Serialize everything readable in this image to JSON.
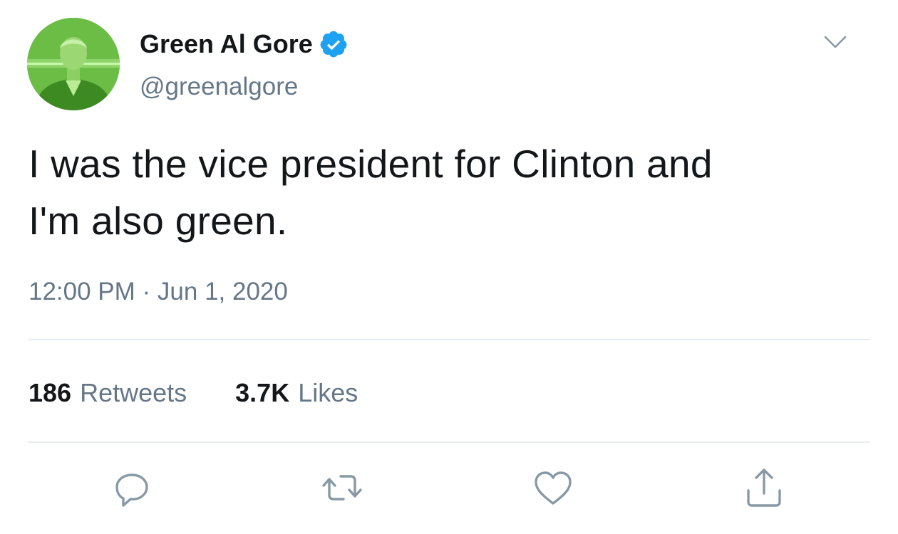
{
  "tweet": {
    "display_name": "Green Al Gore",
    "handle": "@greenalgore",
    "verified": true,
    "text_line1": "I was the vice president for Clinton and",
    "text_line2": "I'm also green.",
    "timestamp": "12:00 PM · Jun 1, 2020"
  },
  "stats": {
    "retweets_count": "186",
    "retweets_label": "Retweets",
    "likes_count": "3.7K",
    "likes_label": "Likes"
  },
  "actions": [
    {
      "icon": "reply-icon"
    },
    {
      "icon": "retweet-icon"
    },
    {
      "icon": "like-icon"
    },
    {
      "icon": "share-icon"
    }
  ],
  "colors": {
    "text_primary": "#14171a",
    "text_secondary": "#657786",
    "verified_blue": "#1da1f2",
    "divider": "#e6ecf0",
    "avatar_tint": "#5fae3a"
  }
}
